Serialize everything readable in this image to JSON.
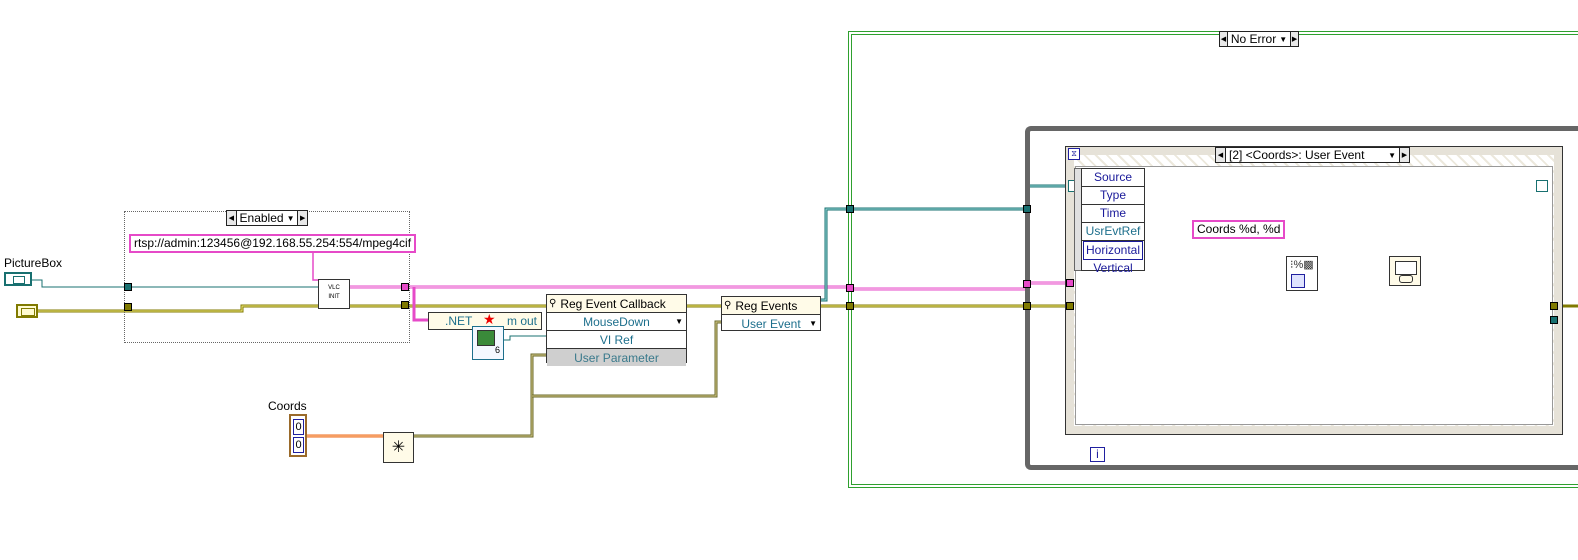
{
  "controls": {
    "picturebox_label": "PictureBox",
    "coords_label": "Coords",
    "coords_values": [
      "0",
      "0"
    ]
  },
  "disable_structure": {
    "selector_label": "Enabled",
    "rtsp_string": "rtsp://admin:123456@192.168.55.254:554/mpeg4cif",
    "vlc_line1": "VLC",
    "vlc_line2": "INIT"
  },
  "dotnet_node": {
    "text_left": ".NET",
    "text_right": "m out",
    "badge": "6"
  },
  "reg_event_callback": {
    "title": "Reg Event Callback",
    "rows": [
      {
        "label": "MouseDown",
        "dropdown": true
      },
      {
        "label": "VI Ref",
        "dropdown": false
      },
      {
        "label": "User Parameter",
        "dropdown": false
      }
    ]
  },
  "reg_events": {
    "title": "Reg Events",
    "rows": [
      {
        "label": "User Event"
      }
    ]
  },
  "case_structure": {
    "selector_label": "No Error"
  },
  "event_structure": {
    "selector_label": "[2] <Coords>: User Event",
    "event_data_node": [
      "Source",
      "Type",
      "Time",
      "UsrEvtRef",
      "Horizontal",
      "Vertical"
    ],
    "format_string": "Coords %d, %d",
    "iteration_label": "i"
  },
  "colors": {
    "cluster_wire": "#e64ac8",
    "refnum_wire": "#187070",
    "error_wire": "#807a00",
    "dbl_wire": "#ee6a1a",
    "int_wire": "#2020a0",
    "loop_border": "#666666",
    "case_border": "#2ea02e"
  },
  "icons": [
    "window-icon",
    "error-cluster-icon",
    "vlc-subvi-icon",
    "star-icon",
    "vi-server-icon",
    "property-icon",
    "format-into-string-icon",
    "display-icon",
    "timeout-icon",
    "tunnel-icon"
  ]
}
